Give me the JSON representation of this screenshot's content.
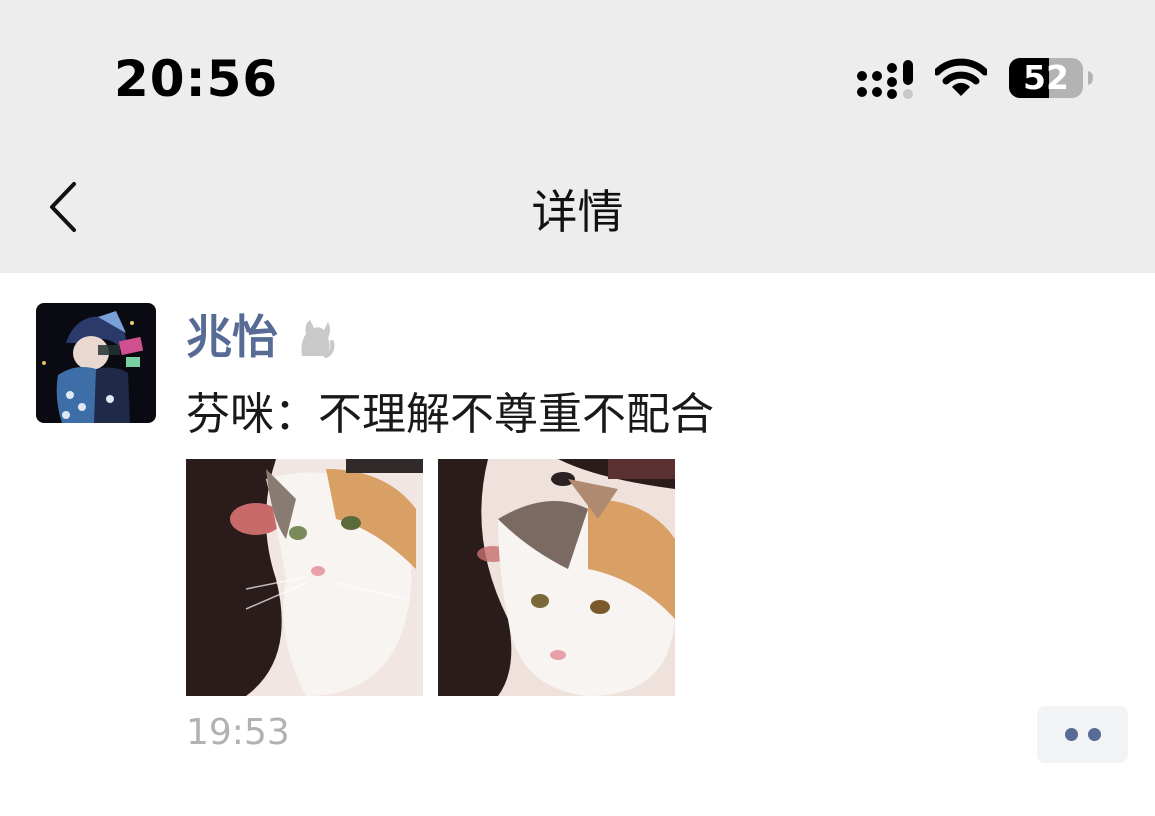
{
  "status_bar": {
    "time": "20:56",
    "battery": "52",
    "icons": [
      "cellular-signal-icon",
      "wifi-icon",
      "battery-icon"
    ]
  },
  "nav": {
    "back_icon": "back-chevron-icon",
    "title": "详情"
  },
  "post": {
    "author": "兆怡",
    "badge_icon": "cat-status-icon",
    "text": "芬咪：不理解不尊重不配合",
    "images": [
      {
        "name": "photo-girl-with-cat-1"
      },
      {
        "name": "photo-girl-with-cat-2"
      }
    ],
    "time": "19:53",
    "more_icon": "more-dots-icon"
  },
  "colors": {
    "header_bg": "#ededed",
    "name_color": "#576b95",
    "time_color": "#b2b2b2"
  }
}
